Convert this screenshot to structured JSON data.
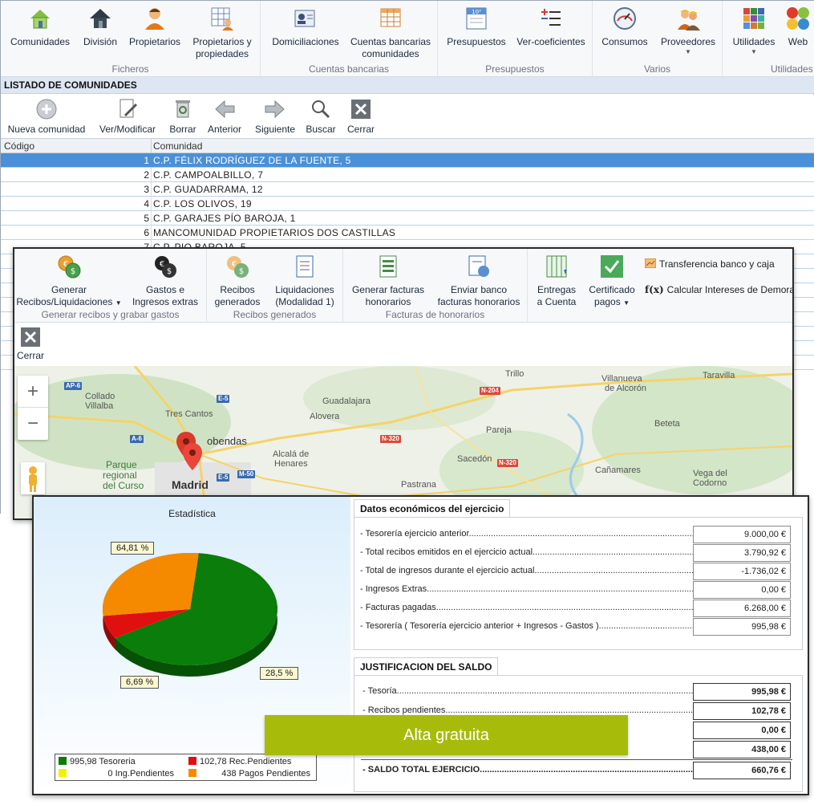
{
  "ribbon": {
    "ficheros": {
      "label": "Ficheros",
      "buttons": [
        {
          "label": "Comunidades",
          "icon": "house-icon"
        },
        {
          "label": "División",
          "icon": "house-dark-icon"
        },
        {
          "label": "Propietarios",
          "icon": "person-icon"
        },
        {
          "label1": "Propietarios y",
          "label2": "propiedades",
          "icon": "owner-grid-icon"
        }
      ]
    },
    "cuentas": {
      "label": "Cuentas bancarias",
      "buttons": [
        {
          "label": "Domiciliaciones",
          "icon": "contact-card-icon"
        },
        {
          "label1": "Cuentas bancarias",
          "label2": "comunidades",
          "icon": "grid-icon"
        }
      ]
    },
    "presupuestos": {
      "label": "Presupuestos",
      "buttons": [
        {
          "label": "Presupuestos",
          "icon": "budget-icon",
          "badge": "10³"
        },
        {
          "label": "Ver-coeficientes",
          "icon": "plus-minus-icon"
        }
      ]
    },
    "varios": {
      "label": "Varios",
      "buttons": [
        {
          "label": "Consumos",
          "icon": "gauge-icon"
        },
        {
          "label": "Proveedores",
          "icon": "workers-icon"
        }
      ]
    },
    "utilidades": {
      "label": "Utilidades",
      "buttons": [
        {
          "label": "Utilidades",
          "icon": "color-grid-icon"
        },
        {
          "label": "Web",
          "icon": "web-dots-icon"
        }
      ]
    }
  },
  "listado": {
    "title": "LISTADO DE COMUNIDADES",
    "toolbar": {
      "nueva": "Nueva comunidad",
      "ver": "Ver/Modificar",
      "borrar": "Borrar",
      "anterior": "Anterior",
      "siguiente": "Siguiente",
      "buscar": "Buscar",
      "cerrar": "Cerrar"
    },
    "columns": {
      "code": "Código",
      "name": "Comunidad"
    },
    "rows": [
      {
        "code": "1",
        "name": "C.P. FÉLIX RODRÍGUEZ DE LA FUENTE, 5"
      },
      {
        "code": "2",
        "name": "C.P. CAMPOALBILLO, 7"
      },
      {
        "code": "3",
        "name": "C.P. GUADARRAMA, 12"
      },
      {
        "code": "4",
        "name": "C.P. LOS OLIVOS, 19"
      },
      {
        "code": "5",
        "name": "C.P. GARAJES PÍO BAROJA, 1"
      },
      {
        "code": "6",
        "name": "MANCOMUNIDAD PROPIETARIOS DOS CASTILLAS"
      },
      {
        "code": "7",
        "name": "C.P. PIO BAROJA, 5"
      }
    ]
  },
  "recibos": {
    "groups": {
      "g1": "Generar recibos y grabar gastos",
      "g2": "Recibos generados",
      "g3": "Facturas de honorarios"
    },
    "buttons": {
      "generar1": "Generar",
      "generar2": "Recibos/Liquidaciones",
      "gastos1": "Gastos e",
      "gastos2": "Ingresos extras",
      "recibos1": "Recibos",
      "recibos2": "generados",
      "liq1": "Liquidaciones",
      "liq2": "(Modalidad 1)",
      "gf1": "Generar facturas",
      "gf2": "honorarios",
      "eb1": "Enviar banco",
      "eb2": "facturas honorarios",
      "ent1": "Entregas",
      "ent2": "a Cuenta",
      "cert1": "Certificado",
      "cert2": "pagos",
      "transferencia": "Transferencia banco y caja",
      "intereses": "Calcular Intereses de Demora",
      "fx": "f(x)",
      "cerrar": "Cerrar"
    }
  },
  "map": {
    "places": {
      "trillo": "Trillo",
      "villanueva1": "Villanueva",
      "villanueva2": "de Alcorón",
      "taravilla": "Taravilla",
      "collado1": "Collado",
      "collado2": "Villalba",
      "guadalajara": "Guadalajara",
      "alovera": "Alovera",
      "tres_cantos": "Tres Cantos",
      "alcobendas": "obendas",
      "beteta": "Beteta",
      "pareja": "Pareja",
      "alcala1": "Alcalá de",
      "alcala2": "Henares",
      "sacedon": "Sacedón",
      "canamares": "Cañamares",
      "vega1": "Vega del",
      "vega2": "Codorno",
      "parque1": "Parque",
      "parque2": "regional",
      "parque3": "del Curso",
      "madrid": "Madrid",
      "pastrana": "Pastrana"
    },
    "roads": {
      "ap6": "AP-6",
      "e5a": "E-5",
      "n204": "N-204",
      "a6": "A-6",
      "n320a": "N-320",
      "n320b": "N-320",
      "e5b": "E-5",
      "m50": "M-50"
    }
  },
  "estadistica": {
    "title": "Estadística",
    "callouts": {
      "big": "64,81 %",
      "mid": "28,5 %",
      "small": "6,69 %"
    },
    "legend": [
      {
        "text": "995,98 Tesoreria",
        "color": "#0a7d0a"
      },
      {
        "text": "102,78 Rec.Pendientes",
        "color": "#e01010"
      },
      {
        "text": "0 Ing.Pendientes",
        "color": "#f2f200"
      },
      {
        "text": "438 Pagos Pendientes",
        "color": "#f58a00"
      }
    ]
  },
  "chart_data": {
    "type": "pie",
    "title": "Estadística",
    "categories": [
      "Tesoreria",
      "Rec.Pendientes",
      "Ing.Pendientes",
      "Pagos Pendientes"
    ],
    "values": [
      995.98,
      102.78,
      0,
      438
    ],
    "percent_labels": [
      "64,81 %",
      "6,69 %",
      "",
      "28,5 %"
    ],
    "colors": [
      "#0a7d0a",
      "#e01010",
      "#f2f200",
      "#f58a00"
    ],
    "legend_position": "bottom"
  },
  "datos": {
    "tab": "Datos económicos del ejercicio",
    "rows": [
      {
        "label": "- Tesorería ejercicio anterior",
        "value": "9.000,00 €"
      },
      {
        "label": "- Total recibos emitidos en el ejercicio actual",
        "value": "3.790,92 €"
      },
      {
        "label": "- Total de ingresos durante el ejercicio actual",
        "value": "-1.736,02 €"
      },
      {
        "label": "- Ingresos Extras",
        "value": "0,00 €"
      },
      {
        "label": "- Facturas pagadas",
        "value": "6.268,00 €"
      },
      {
        "label": "- Tesorería ( Tesorería ejercicio anterior + Ingresos - Gastos )",
        "value": "995,98 €"
      }
    ]
  },
  "justificacion": {
    "tab": "JUSTIFICACION DEL SALDO",
    "rows": [
      {
        "label": "- Tesoría",
        "value": "995,98 €"
      },
      {
        "label": "- Recibos pendientes",
        "value": "102,78 €"
      },
      {
        "label": "",
        "value": "0,00 €"
      },
      {
        "label": "",
        "value": "438,00 €"
      },
      {
        "label": "- SALDO TOTAL EJERCICIO",
        "value": "660,76 €"
      }
    ]
  },
  "cta": {
    "label": "Alta gratuita",
    "color": "#a7bb0b"
  }
}
